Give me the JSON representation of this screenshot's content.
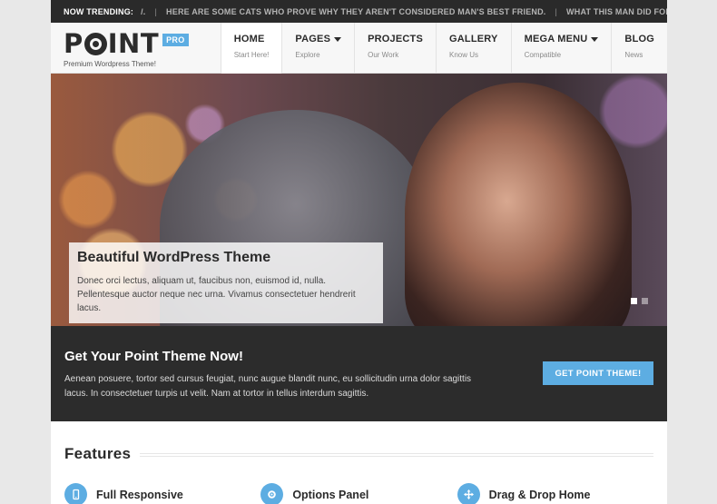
{
  "trending": {
    "label": "NOW TRENDING:",
    "items": [
      "/.",
      "HERE ARE SOME CATS WHO PROVE WHY THEY AREN'T CONSIDERED MAN'S BEST FRIEND.",
      "WHAT THIS MAN DID FOR THE WOMAN HE LOVES M"
    ]
  },
  "logo": {
    "text_pre": "P",
    "text_post": "INT",
    "badge": "PRO",
    "tagline": "Premium Wordpress Theme!"
  },
  "nav": [
    {
      "title": "HOME",
      "sub": "Start Here!",
      "active": true,
      "dropdown": false
    },
    {
      "title": "PAGES",
      "sub": "Explore",
      "active": false,
      "dropdown": true
    },
    {
      "title": "PROJECTS",
      "sub": "Our Work",
      "active": false,
      "dropdown": false
    },
    {
      "title": "GALLERY",
      "sub": "Know Us",
      "active": false,
      "dropdown": false
    },
    {
      "title": "MEGA MENU",
      "sub": "Compatible",
      "active": false,
      "dropdown": true
    },
    {
      "title": "BLOG",
      "sub": "News",
      "active": false,
      "dropdown": false
    }
  ],
  "slider": {
    "title": "Beautiful WordPress Theme",
    "text": "Donec orci lectus, aliquam ut, faucibus non, euismod id, nulla. Pellentesque auctor neque nec urna. Vivamus consectetuer hendrerit lacus.",
    "slide_count": 2,
    "active_slide": 1
  },
  "cta": {
    "title": "Get Your Point Theme Now!",
    "text": "Aenean posuere, tortor sed cursus feugiat, nunc augue blandit nunc, eu sollicitudin urna dolor sagittis lacus. In consectetuer turpis ut velit. Nam at tortor in tellus interdum sagittis.",
    "button": "GET POINT THEME!"
  },
  "features": {
    "heading": "Features",
    "items": [
      {
        "label": "Full Responsive",
        "icon": "mobile-icon"
      },
      {
        "label": "Options Panel",
        "icon": "gear-icon"
      },
      {
        "label": "Drag & Drop Home",
        "icon": "move-arrows-icon"
      }
    ]
  },
  "colors": {
    "accent": "#5dade2",
    "dark": "#2c2c2c",
    "trending_bg": "#2a2a2a"
  }
}
